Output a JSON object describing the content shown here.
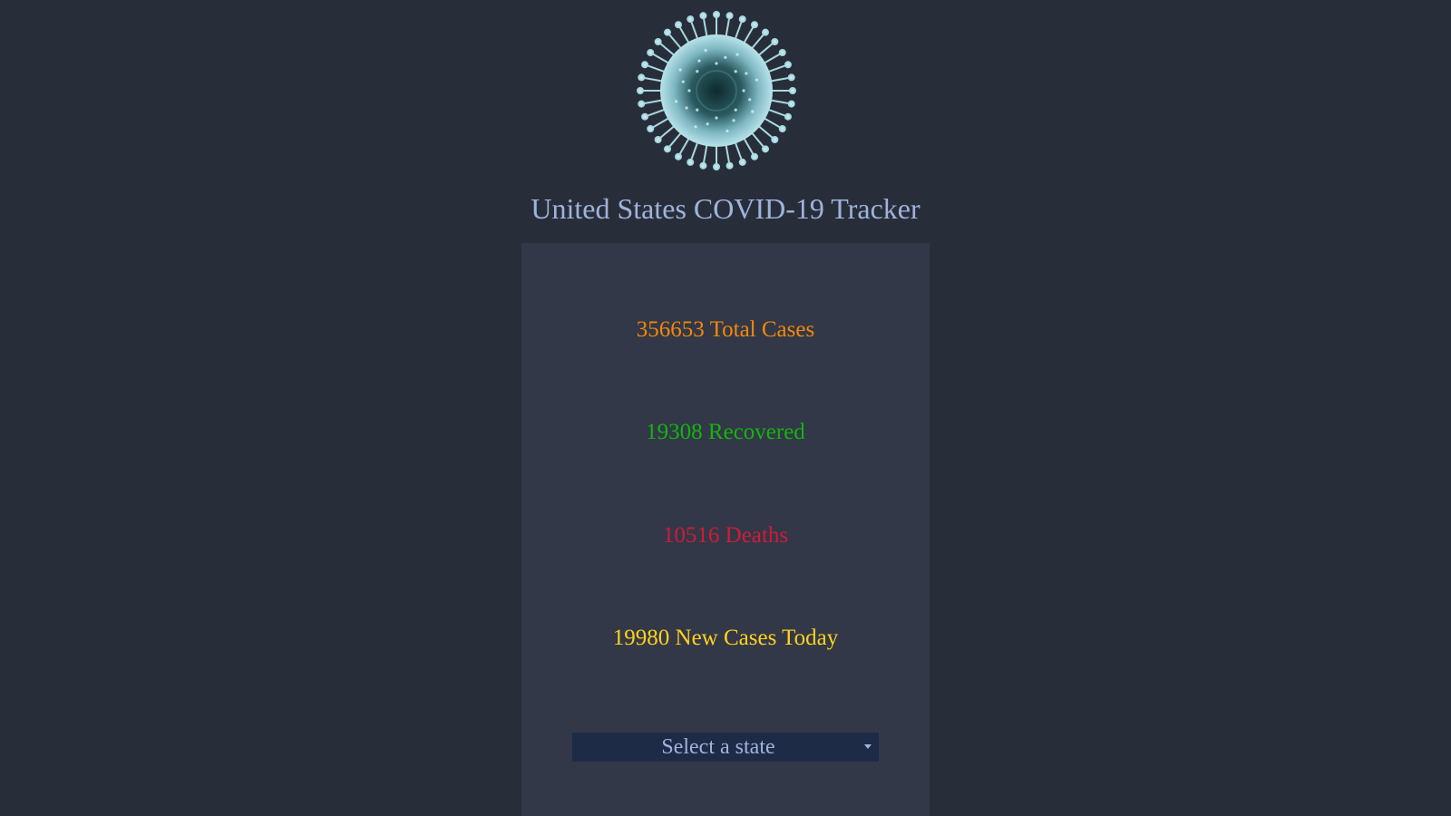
{
  "header": {
    "logo_icon": "coronavirus-icon",
    "title": "United States COVID-19 Tracker"
  },
  "stats": {
    "total_cases": "356653 Total Cases",
    "recovered": "19308 Recovered",
    "deaths": "10516 Deaths",
    "new_cases_today": "19980 New Cases Today"
  },
  "state_select": {
    "selected_label": "Select a state"
  },
  "colors": {
    "background": "#282e39",
    "panel": "#323847",
    "title": "#9fb3dd",
    "total_cases": "#f3870b",
    "recovered": "#15b30f",
    "deaths": "#d11a3a",
    "new_cases": "#ffd21f",
    "select_bg": "#1e2b47"
  }
}
